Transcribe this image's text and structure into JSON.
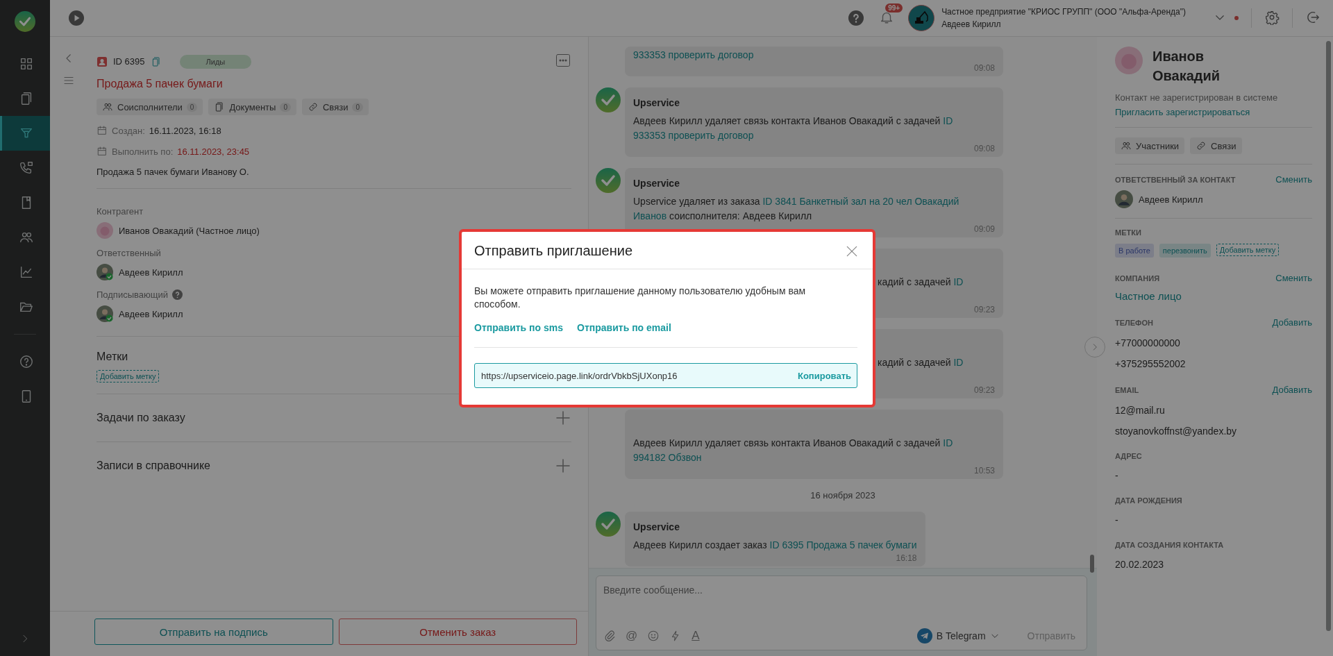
{
  "sidebar": {
    "items": [
      {
        "selected": false
      },
      {
        "selected": false
      },
      {
        "selected": true
      },
      {
        "selected": false
      },
      {
        "selected": false
      },
      {
        "selected": false
      },
      {
        "selected": false
      },
      {
        "selected": false
      }
    ],
    "bottom_items": [
      {
        "selected": false
      },
      {
        "selected": false
      }
    ]
  },
  "topbar": {
    "badge": "99+",
    "company": "Частное предприятие \"КРИОС ГРУПП\" (ООО \"Альфа-Аренда\")",
    "user": "Авдеев Кирилл"
  },
  "order": {
    "id": "ID 6395",
    "stage": "Лиды",
    "title": "Продажа 5 пачек бумаги",
    "chips": [
      {
        "kind": "people",
        "label": "Соисполнители",
        "count": "0"
      },
      {
        "kind": "docs",
        "label": "Документы",
        "count": "0"
      },
      {
        "kind": "link",
        "label": "Связи",
        "count": "0"
      }
    ],
    "dates": [
      {
        "label": "Создан:",
        "value": "16.11.2023, 16:18",
        "overdue": false
      },
      {
        "label": "Выполнить по:",
        "value": "16.11.2023, 23:45",
        "overdue": true
      }
    ],
    "description": "Продажа 5 пачек бумаги Иванову О.",
    "fields": [
      {
        "label": "Контрагент",
        "help": false,
        "kind": "contact",
        "person": "Иванов Овакадий (Частное лицо)"
      },
      {
        "label": "Ответственный",
        "help": false,
        "kind": "user",
        "person": "Авдеев Кирилл"
      },
      {
        "label": "Подписывающий",
        "help": true,
        "kind": "user",
        "person": "Авдеев Кирилл"
      }
    ],
    "tags_title": "Метки",
    "add_tag": "Добавить метку",
    "sections": [
      {
        "title": "Задачи по заказу"
      },
      {
        "title": "Записи в справочнике"
      }
    ],
    "buttons": [
      {
        "kind": "primary",
        "label": "Отправить на подпись"
      },
      {
        "kind": "danger",
        "label": "Отменить заказ"
      }
    ]
  },
  "chat": {
    "messages": [
      {
        "kind": "tail",
        "parts": [
          {
            "text": "933353 проверить договор",
            "link": true
          }
        ],
        "time": "09:08"
      },
      {
        "kind": "full",
        "sender": "Upservice",
        "parts": [
          {
            "text": "Авдеев Кирилл удаляет связь контакта Иванов Овакадий с задачей ",
            "link": false
          },
          {
            "text": "ID",
            "link": true
          },
          {
            "text": "933353 проверить договор",
            "link": true
          }
        ],
        "time": "09:08"
      },
      {
        "kind": "full",
        "sender": "Upservice",
        "parts": [
          {
            "text": "Upservice удаляет из заказа ",
            "link": false
          },
          {
            "text": "ID 3841 Банкетный зал на 20 чел Овакадий",
            "link": true
          },
          {
            "text": "Иванов",
            "link": true
          },
          {
            "text": " соисполнителя: Авдеев Кирилл",
            "link": false
          }
        ],
        "time": "09:09"
      },
      {
        "kind": "covered",
        "parts": [
          {
            "text": "кадий с задачей ",
            "link": false
          },
          {
            "text": "ID",
            "link": true
          }
        ],
        "time": "09:23"
      },
      {
        "kind": "covered",
        "parts": [
          {
            "text": "кадий с задачей ",
            "link": false
          },
          {
            "text": "ID",
            "link": true
          }
        ],
        "time": "09:23"
      },
      {
        "kind": "covered_top",
        "parts": [
          {
            "text": "Авдеев Кирилл удаляет связь контакта Иванов Овакадий с задачей ",
            "link": false
          },
          {
            "text": "ID",
            "link": true
          },
          {
            "text": "994182 Обзвон",
            "link": true
          }
        ],
        "time": "10:53"
      },
      {
        "kind": "date",
        "text": "16 ноября 2023"
      },
      {
        "kind": "full",
        "sender": "Upservice",
        "parts": [
          {
            "text": "Авдеев Кирилл создает заказ ",
            "link": false
          },
          {
            "text": "ID 6395 Продажа 5 пачек бумаги",
            "link": true
          }
        ],
        "time": "16:18"
      }
    ],
    "composer": {
      "placeholder": "Введите сообщение...",
      "tools": [
        {
          "kind": "attach"
        },
        {
          "kind": "mention",
          "glyph": "@"
        },
        {
          "kind": "emoji"
        },
        {
          "kind": "quick"
        },
        {
          "kind": "format",
          "glyph": "A"
        }
      ],
      "channel": "В Telegram",
      "send": "Отправить",
      "send_disabled": true
    }
  },
  "contact": {
    "name": "Иванов Овакадий",
    "status": "Контакт не зарегистрирован в системе",
    "invite": "Пригласить зарегистрироваться",
    "chips": [
      {
        "kind": "people",
        "label": "Участники"
      },
      {
        "kind": "link",
        "label": "Связи"
      }
    ],
    "responsible": {
      "label": "ОТВЕТСТВЕННЫЙ ЗА КОНТАКТ",
      "action": "Сменить",
      "person": "Авдеев Кирилл"
    },
    "tags": {
      "label": "МЕТКИ",
      "items": [
        {
          "text": "В работе",
          "kind": "status"
        },
        {
          "text": "перезвонить",
          "kind": "reminder"
        }
      ],
      "add": "Добавить метку"
    },
    "fields": [
      {
        "label": "КОМПАНИЯ",
        "action": "Сменить",
        "kind": "link",
        "values": [
          "Частное лицо"
        ]
      },
      {
        "label": "ТЕЛЕФОН",
        "action": "Добавить",
        "kind": "plain",
        "values": [
          "+77000000000",
          "+375295552002"
        ]
      },
      {
        "label": "EMAIL",
        "action": "Добавить",
        "kind": "plain",
        "values": [
          "12@mail.ru",
          "stoyanovkoffnst@yandex.by"
        ]
      },
      {
        "label": "АДРЕС",
        "kind": "plain",
        "values": [
          "-"
        ]
      },
      {
        "label": "ДАТА РОЖДЕНИЯ",
        "kind": "plain",
        "values": [
          "-"
        ]
      },
      {
        "label": "ДАТА СОЗДАНИЯ КОНТАКТА",
        "kind": "plain",
        "values": [
          "20.02.2023"
        ]
      }
    ]
  },
  "modal": {
    "title": "Отправить приглашение",
    "text": "Вы можете отправить приглашение данному пользователю удобным вам способом.",
    "links": [
      "Отправить по sms",
      "Отправить по email"
    ],
    "url": "https://upserviceio.page.link/ordrVbkbSjUXonp16",
    "copy": "Копировать"
  }
}
